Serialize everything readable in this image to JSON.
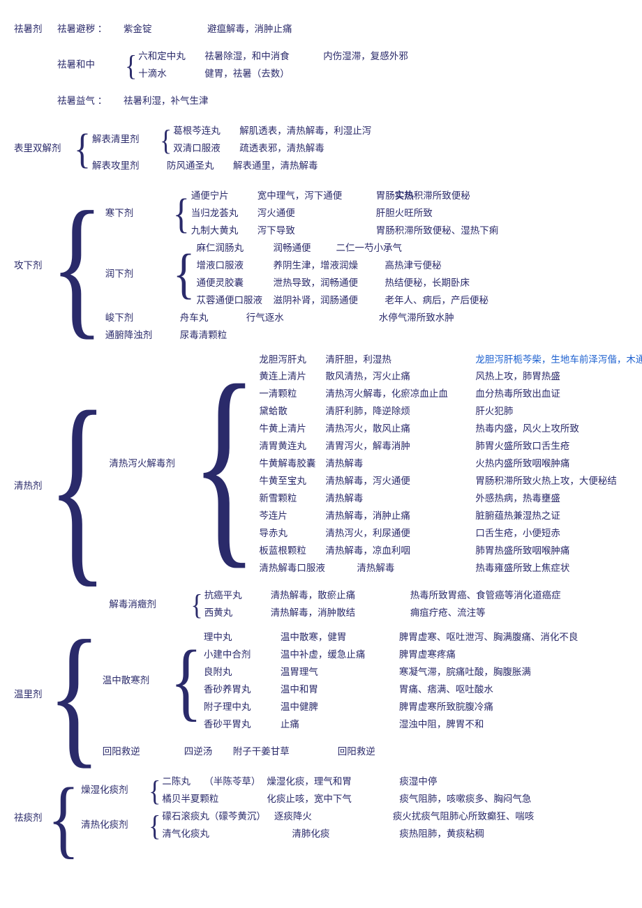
{
  "qushu": {
    "title": "祛暑剂",
    "bichu": {
      "lbl": "祛暑避秽 ：",
      "med": "紫金锭",
      "eff": "避瘟解毒，消肿止痛"
    },
    "hezhong": {
      "lbl": "祛暑和中",
      "rows": [
        {
          "med": "六和定中丸",
          "eff": "祛暑除湿，和中消食",
          "ind": "内伤湿滞，复感外邪"
        },
        {
          "med": "十滴水",
          "eff": "健胃，祛暑（去数）",
          "ind": ""
        }
      ]
    },
    "yiqi": {
      "lbl": "祛暑益气 ：",
      "eff": "祛暑利湿，补气生津"
    }
  },
  "blsj": {
    "title": "表里双解剂",
    "qingli": {
      "lbl": "解表清里剂",
      "rows": [
        {
          "med": "葛根芩连丸",
          "eff": "解肌透表，清热解毒，利湿止泻"
        },
        {
          "med": "双清口服液",
          "eff": "疏透表邪，清热解毒"
        }
      ]
    },
    "gongli": {
      "lbl": "解表攻里剂",
      "med": "防风通圣丸",
      "eff": "解表通里，清热解毒"
    }
  },
  "gongxia": {
    "title": "攻下剂",
    "hanxia": {
      "lbl": "寒下剂",
      "rows": [
        {
          "med": "通便宁片",
          "eff": "宽中理气，泻下通便",
          "ind_pre": "胃肠",
          "ind_bold": "实热",
          "ind_post": "积滞所致便秘"
        },
        {
          "med": "当归龙荟丸",
          "eff": "泻火通便",
          "ind": "肝胆火旺所致"
        },
        {
          "med": "九制大黄丸",
          "eff": "泻下导致",
          "ind": "胃肠积滞所致便秘、湿热下痢"
        }
      ]
    },
    "runxia": {
      "lbl": "润下剂",
      "rows": [
        {
          "med": "麻仁润肠丸",
          "eff": "润畅通便",
          "ind": "二仁一芍小承气"
        },
        {
          "med": "增液口服液",
          "eff": "养阴生津，增液润燥",
          "ind": "高热津亏便秘"
        },
        {
          "med": "通便灵胶囊",
          "eff": "泄热导致，润畅通便",
          "ind": "热结便秘，长期卧床"
        },
        {
          "med": "苁蓉通便口服液",
          "eff": "滋阴补肾，润肠通便",
          "ind": "老年人、病后，产后便秘"
        }
      ]
    },
    "junxia": {
      "lbl": "峻下剂",
      "med": "舟车丸",
      "eff": "行气逐水",
      "ind": "水停气滞所致水肿"
    },
    "tongfu": {
      "lbl": "通腑降浊剂",
      "med": "尿毒清颗粒",
      "eff": "",
      "ind": ""
    }
  },
  "qingre": {
    "title": "清热剂",
    "xiehuo": {
      "lbl": "清热泻火解毒剂",
      "rows": [
        {
          "med": "龙胆泻肝丸",
          "eff": "清肝胆，利湿热",
          "ind": "",
          "blue": "龙胆泻肝栀芩柴，生地车前泽泻偕，木通甘草当归合"
        },
        {
          "med": "黄连上清片",
          "eff": "散风清热，泻火止痛",
          "ind": "风热上攻，肺胃热盛"
        },
        {
          "med": "一清颗粒",
          "eff": "清热泻火解毒，化瘀凉血止血",
          "ind": "血分热毒所致出血证"
        },
        {
          "med": "黛蛤散",
          "eff": "清肝利肺，降逆除烦",
          "ind": "肝火犯肺"
        },
        {
          "med": "牛黄上清片",
          "eff": "清热泻火，散风止痛",
          "ind": "热毒内盛，风火上攻所致"
        },
        {
          "med": "清胃黄连丸",
          "eff": "清胃泻火，解毒消肿",
          "ind": "肺胃火盛所致口舌生疮"
        },
        {
          "med": "牛黄解毒胶囊",
          "eff": "清热解毒",
          "ind": "火热内盛所致咽喉肿痛"
        },
        {
          "med": "牛黄至宝丸",
          "eff": "清热解毒，泻火通便",
          "ind": "胃肠积滞所致火热上攻，大便秘结"
        },
        {
          "med": "新雪颗粒",
          "eff": "清热解毒",
          "ind": "外感热病，热毒壅盛"
        },
        {
          "med": "芩连片",
          "eff": "清热解毒，消肿止痛",
          "ind": "脏腑蕴热兼湿热之证"
        },
        {
          "med": "导赤丸",
          "eff": "清热泻火，利尿通便",
          "ind": "口舌生疮，小便短赤"
        },
        {
          "med": "板蓝根颗粒",
          "eff": "清热解毒，凉血利咽",
          "ind": "肺胃热盛所致咽喉肿痛"
        },
        {
          "med": "清热解毒口服液",
          "eff": "清热解毒",
          "ind": "热毒雍盛所致上焦症状"
        }
      ]
    },
    "jiedu": {
      "lbl": "解毒消癥剂",
      "rows": [
        {
          "med": "抗癌平丸",
          "eff": "清热解毒，散瘀止痛",
          "ind": "热毒所致胃癌、食管癌等消化道癌症"
        },
        {
          "med": "西黄丸",
          "eff": "清热解毒，消肿散结",
          "ind": "痈疽疔疮、流注等"
        }
      ]
    }
  },
  "wenli": {
    "title": "温里剂",
    "sanhan": {
      "lbl": "温中散寒剂",
      "rows": [
        {
          "med": "理中丸",
          "eff": "温中散寒，健胃",
          "ind": "脾胃虚寒、呕吐泄泻、胸满腹痛、消化不良"
        },
        {
          "med": "小建中合剂",
          "eff": "温中补虚，缓急止痛",
          "ind": "脾胃虚寒疼痛"
        },
        {
          "med": "良附丸",
          "eff": "温胃理气",
          "ind": "寒凝气滞，脘痛吐酸，胸腹胀满"
        },
        {
          "med": "香砂养胃丸",
          "eff": "温中和胃",
          "ind": "胃痛、痞满、呕吐酸水"
        },
        {
          "med": "附子理中丸",
          "eff": "温中健脾",
          "ind": "脾胃虚寒所致脘腹冷痛"
        },
        {
          "med": "香砂平胃丸",
          "eff": "止痛",
          "ind": "湿浊中阻，脾胃不和"
        }
      ]
    },
    "huiyang": {
      "lbl": "回阳救逆",
      "med": "四逆汤",
      "comp": "附子干姜甘草",
      "eff": "回阳救逆"
    }
  },
  "qutan": {
    "title": "祛痰剂",
    "zaoshi": {
      "lbl": "燥湿化痰剂",
      "rows": [
        {
          "med": "二陈丸",
          "comp": "（半陈苓草）",
          "eff": "燥湿化痰，理气和胃",
          "ind": "痰湿中停"
        },
        {
          "med": "橘贝半夏颗粒",
          "comp": "",
          "eff": "化痰止咳，宽中下气",
          "ind": "痰气阻肺，咳嗽痰多、胸闷气急"
        }
      ]
    },
    "qingre": {
      "lbl": "清热化痰剂",
      "rows": [
        {
          "med": "礞石滚痰丸",
          "comp": "（礞芩黄沉）",
          "eff": "逐痰降火",
          "ind": "痰火扰痰气阻肺心所致癫狂、喘咳"
        },
        {
          "med": "清气化痰丸",
          "comp": "",
          "eff": "清肺化痰",
          "ind": "痰热阻肺，黄痰粘稠"
        }
      ]
    }
  }
}
